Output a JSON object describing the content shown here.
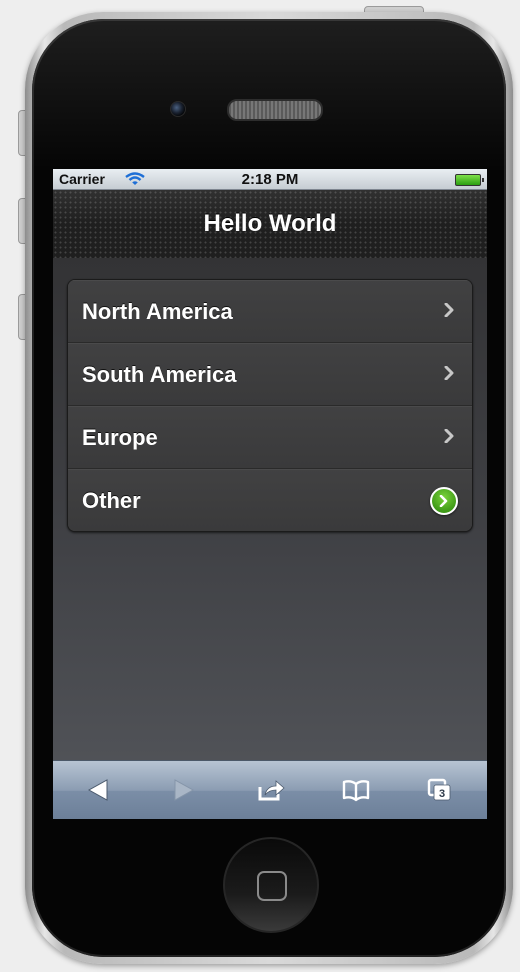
{
  "status_bar": {
    "carrier": "Carrier",
    "time": "2:18 PM"
  },
  "nav": {
    "title": "Hello World"
  },
  "list": {
    "items": [
      {
        "label": "North America",
        "accessory": "chevron-icon"
      },
      {
        "label": "South America",
        "accessory": "chevron-icon"
      },
      {
        "label": "Europe",
        "accessory": "chevron-icon"
      },
      {
        "label": "Other",
        "accessory": "detail-disclosure-icon"
      }
    ]
  },
  "toolbar": {
    "tabs_count": "3",
    "buttons": [
      "back-icon",
      "forward-icon",
      "share-icon",
      "bookmarks-icon",
      "tabs-icon"
    ]
  },
  "colors": {
    "disclosure_green": "#3f9a18",
    "toolbar_blue": "#8b9cb2",
    "navbar": "#1f1f1f"
  }
}
